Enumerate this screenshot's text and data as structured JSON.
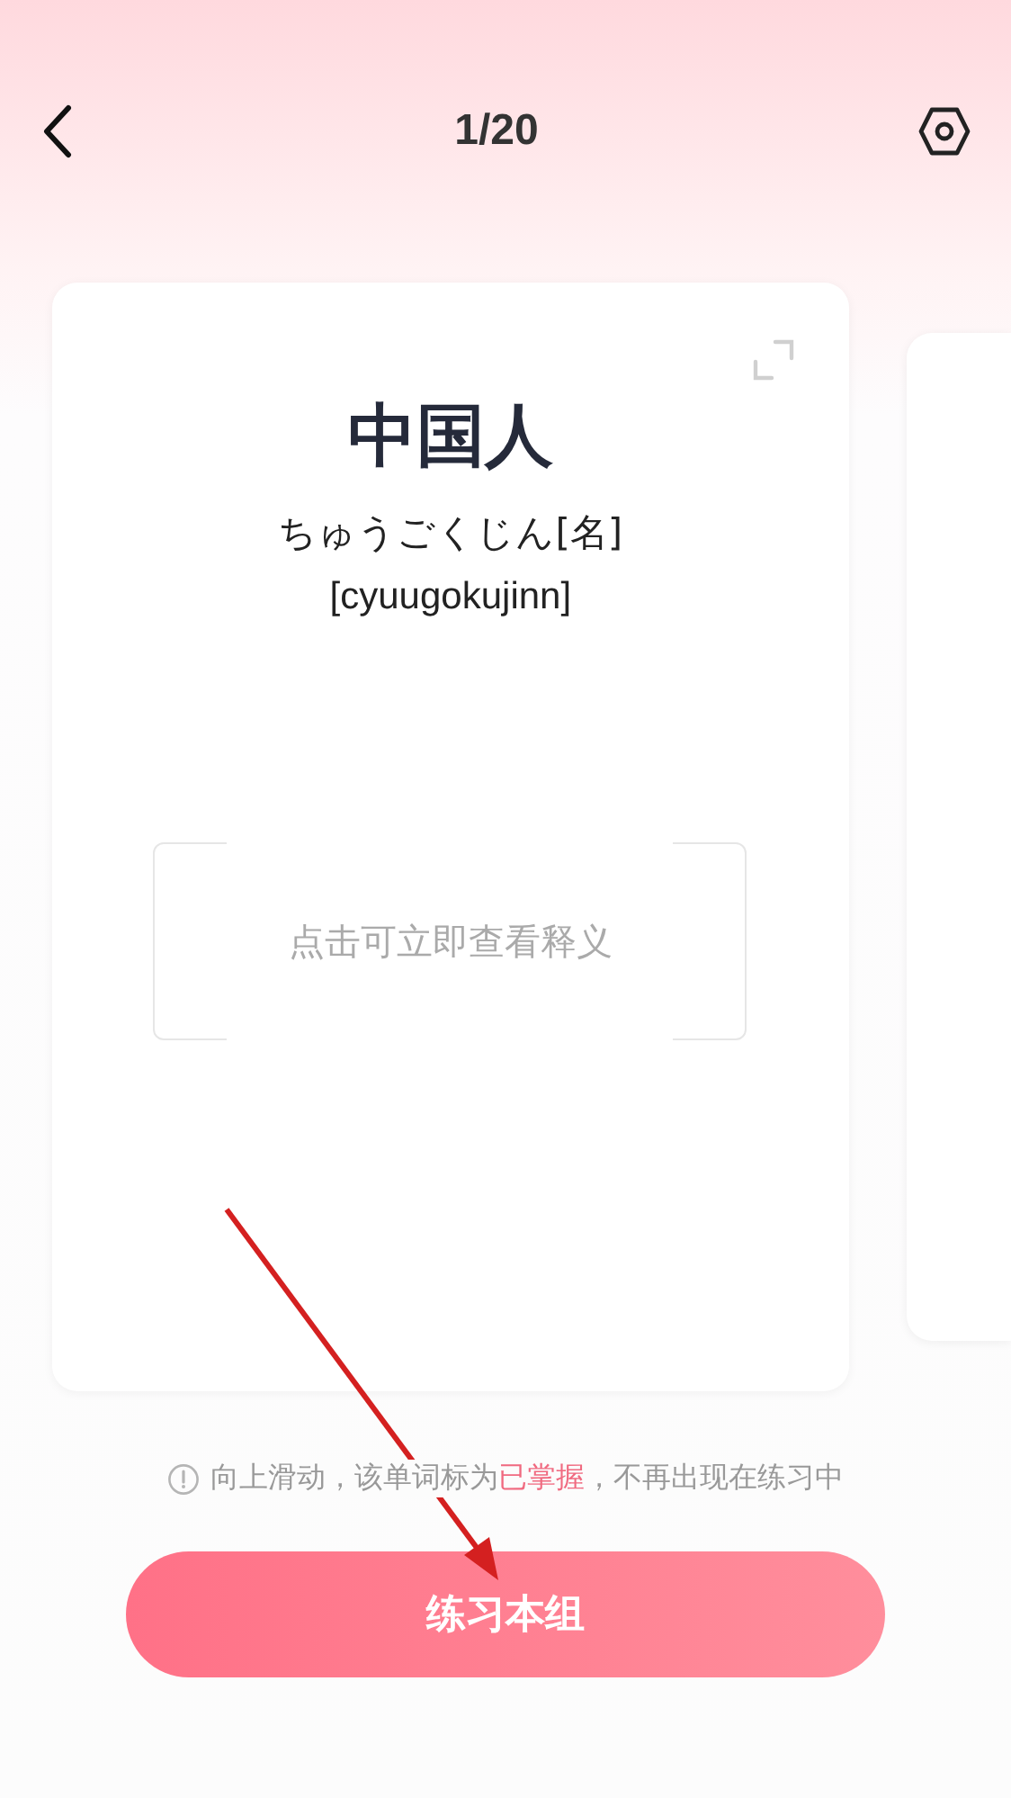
{
  "header": {
    "title": "1/20"
  },
  "card": {
    "word": "中国人",
    "reading": "ちゅうごくじん[名]",
    "romaji": "[cyuugokujinn]",
    "reveal_prompt": "点击可立即查看释义"
  },
  "hint": {
    "before": "向上滑动，该单词标为",
    "highlight": "已掌握",
    "after": "，不再出现在练习中"
  },
  "primary_button": {
    "label": "练习本组"
  }
}
